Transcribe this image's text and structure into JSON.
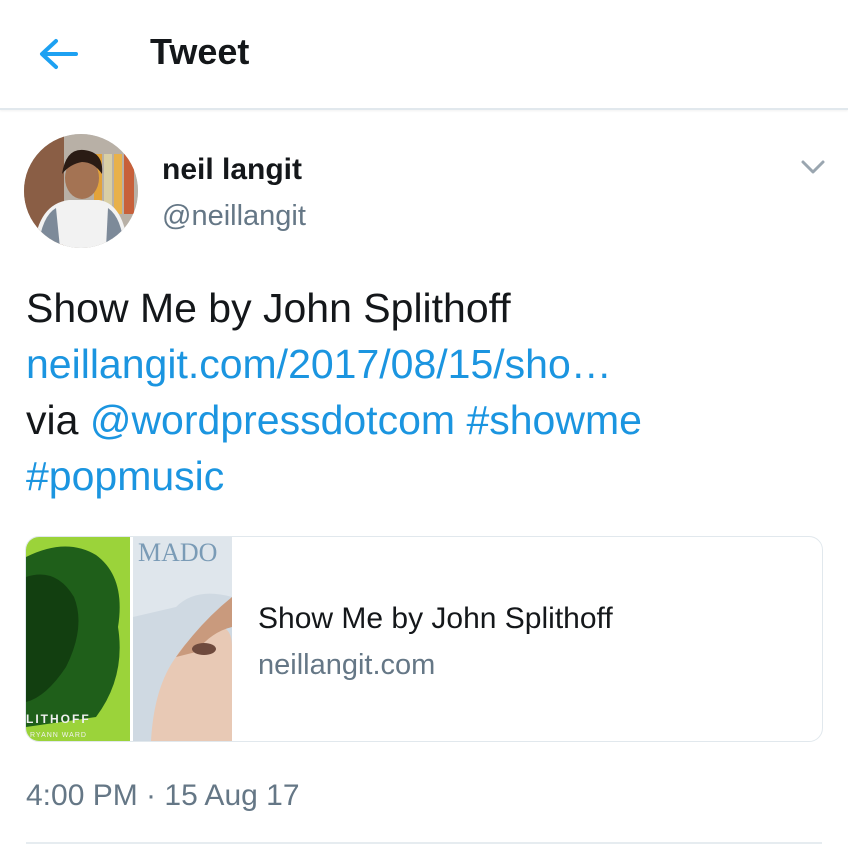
{
  "header": {
    "title": "Tweet",
    "back_icon": "arrow-left-icon",
    "accent": "#1da1f2"
  },
  "author": {
    "name": "neil langit",
    "handle": "@neillangit",
    "avatar_icon": "avatar-photo",
    "menu_icon": "chevron-down-icon"
  },
  "tweet": {
    "line1": "Show Me by John Splithoff",
    "link": "neillangit.com/2017/08/15/sho…",
    "via": "via",
    "mention": "@wordpressdotcom",
    "hashtag1": "#showme",
    "hashtag2": "#popmusic",
    "link_color": "#1b95e0"
  },
  "card": {
    "image_left_text": "LITHOFF",
    "image_left_subtext": "RYANN WARD",
    "image_right_text": "MADO",
    "title": "Show Me by John Splithoff",
    "domain": "neillangit.com"
  },
  "timestamp": "4:00 PM · 15 Aug 17"
}
